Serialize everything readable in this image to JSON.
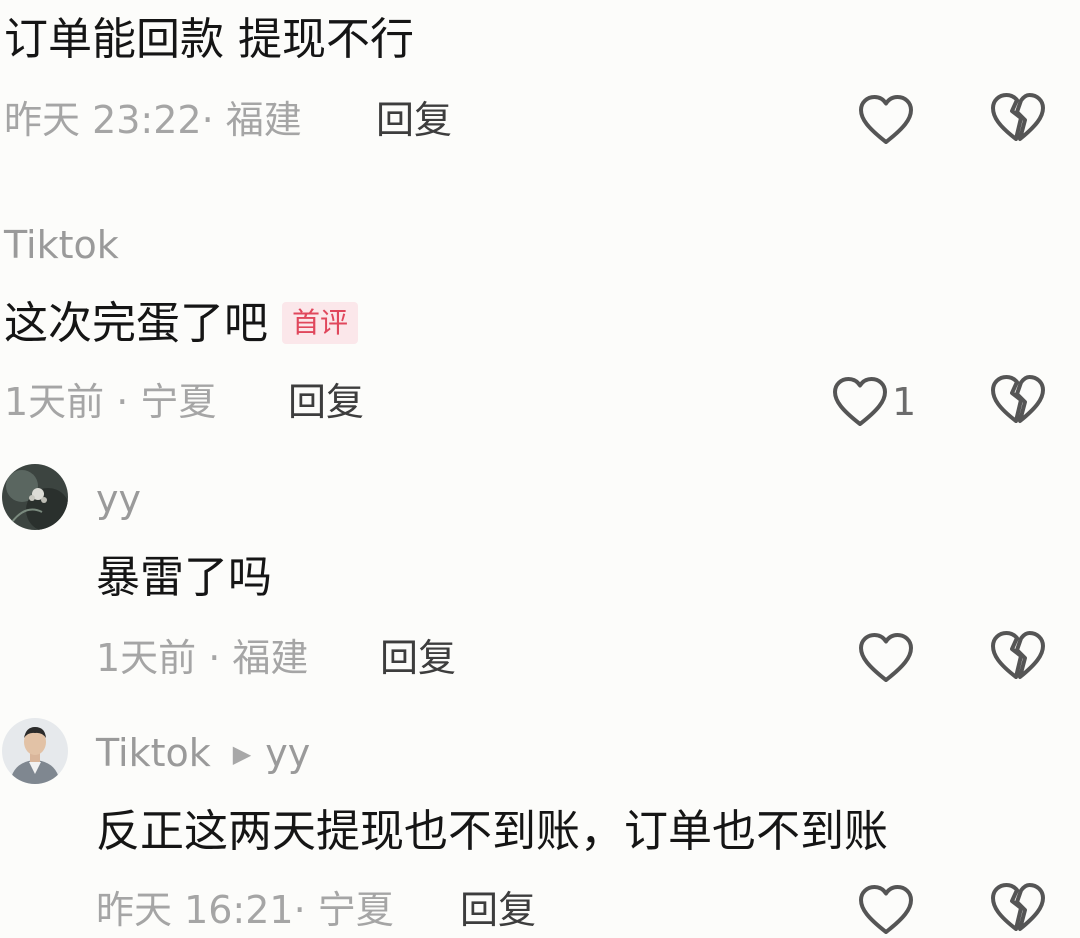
{
  "comments": [
    {
      "text": "订单能回款 提现不行",
      "meta": "昨天 23:22· 福建",
      "reply_label": "回复"
    },
    {
      "user": "Tiktok",
      "text": "这次完蛋了吧",
      "badge": "首评",
      "meta": "1天前 · 宁夏",
      "reply_label": "回复",
      "like_count": "1"
    },
    {
      "user": "yy",
      "text": "暴雷了吗",
      "meta": "1天前 · 福建",
      "reply_label": "回复"
    },
    {
      "user": "Tiktok",
      "reply_to": "yy",
      "text": "反正这两天提现也不到账，订单也不到账",
      "meta": "昨天 16:21· 宁夏",
      "reply_label": "回复"
    }
  ],
  "icons": {
    "like": "heart-outline-icon",
    "dislike": "broken-heart-outline-icon",
    "reply_to": "play-triangle-icon"
  },
  "colors": {
    "badge_text": "#e0475c",
    "badge_bg": "#fbe7ea",
    "meta_text": "#a5a5a5"
  }
}
